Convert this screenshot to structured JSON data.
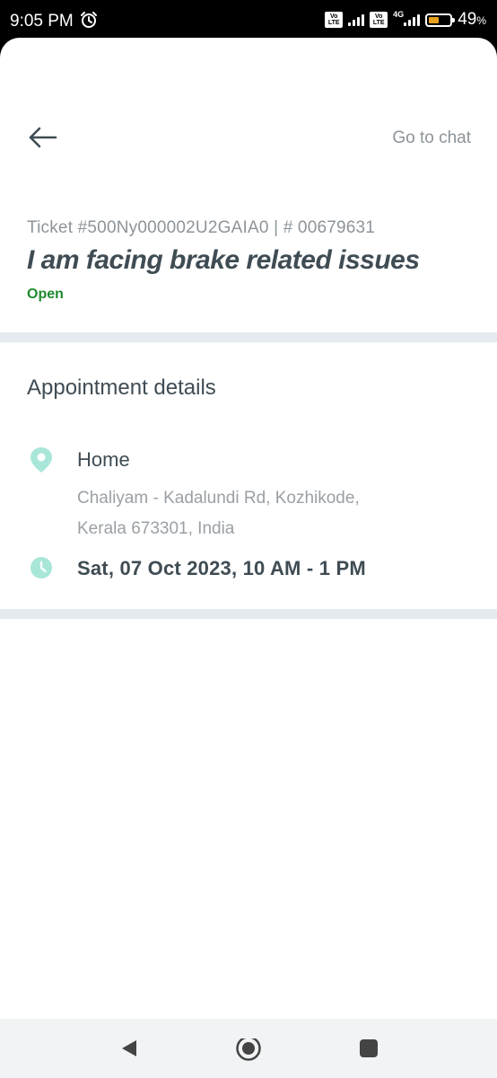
{
  "status_bar": {
    "time": "9:05 PM",
    "sim1_tag": "Vo LTE",
    "sim2_tag": "Vo LTE",
    "network": "4G",
    "battery_percent": "49",
    "battery_unit": "%",
    "battery_level": 0.49,
    "battery_color": "#e8a020",
    "icons": [
      "alarm-icon",
      "volte-icon",
      "signal-icon",
      "battery-icon"
    ]
  },
  "header": {
    "back_icon": "arrow-left-icon",
    "chat_label": "Go to chat"
  },
  "ticket": {
    "id_line": "Ticket #500Ny000002U2GAIA0 | # 00679631",
    "title": "I am facing brake related issues",
    "status": "Open",
    "status_color": "#1f8a2e"
  },
  "appointment": {
    "section_title": "Appointment details",
    "location_icon": "location-pin-icon",
    "place_name": "Home",
    "address_line1": "Chaliyam - Kadalundi Rd, Kozhikode,",
    "address_line2": "Kerala 673301, India",
    "time_icon": "clock-icon",
    "slot": "Sat, 07 Oct 2023, 10 AM - 1 PM"
  },
  "nav_bar": {
    "icons": [
      "nav-back-icon",
      "nav-home-icon",
      "nav-recents-icon"
    ]
  },
  "colors": {
    "text_primary": "#3f4c54",
    "text_secondary": "#8d9499",
    "divider": "#e4eaed",
    "icon_accent": "#a8e6d8"
  }
}
